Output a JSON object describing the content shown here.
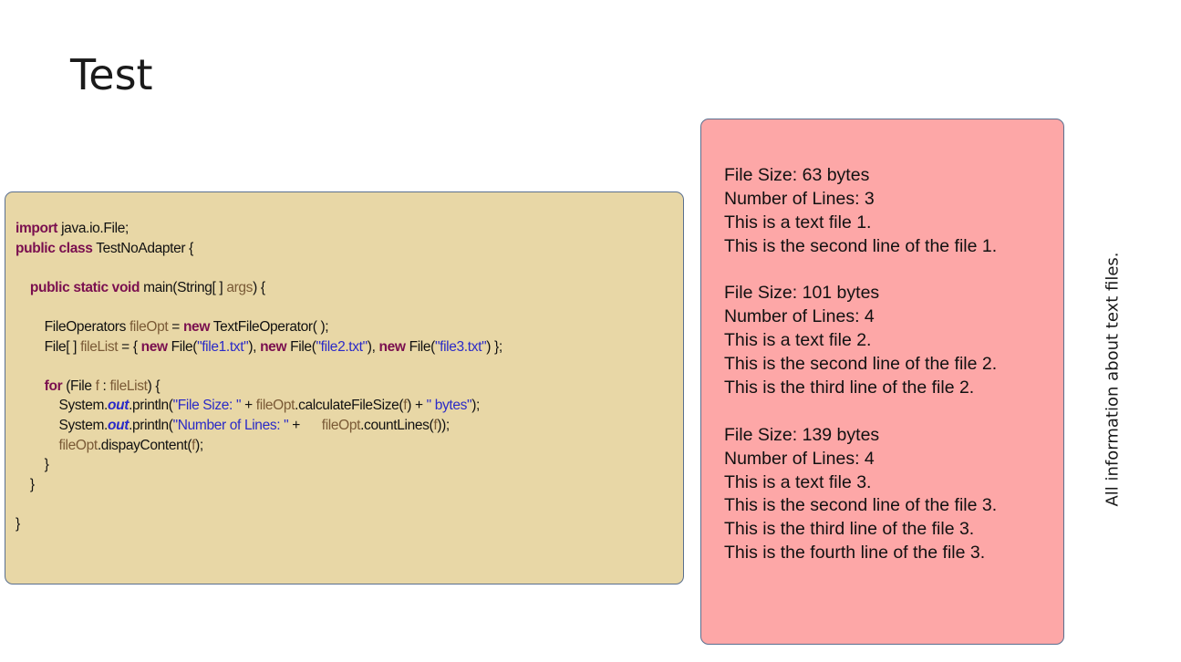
{
  "slide": {
    "title": "Test",
    "side_note": "All information about text files."
  },
  "code": {
    "lines": [
      [
        {
          "t": "import",
          "s": "kw"
        },
        {
          "t": " java.io.File;"
        }
      ],
      [
        {
          "t": "public class",
          "s": "kw"
        },
        {
          "t": " TestNoAdapter {"
        }
      ],
      [
        {
          "t": ""
        }
      ],
      [
        {
          "t": "    "
        },
        {
          "t": "public static void",
          "s": "kw"
        },
        {
          "t": " main(String[ ] "
        },
        {
          "t": "args",
          "s": "var"
        },
        {
          "t": ") {"
        }
      ],
      [
        {
          "t": ""
        }
      ],
      [
        {
          "t": "        FileOperators "
        },
        {
          "t": "fileOpt",
          "s": "var"
        },
        {
          "t": " = "
        },
        {
          "t": "new",
          "s": "kw"
        },
        {
          "t": " TextFileOperator( );"
        }
      ],
      [
        {
          "t": "        File[ ] "
        },
        {
          "t": "fileList",
          "s": "var"
        },
        {
          "t": " = { "
        },
        {
          "t": "new",
          "s": "kw"
        },
        {
          "t": " File("
        },
        {
          "t": "\"file1.txt\"",
          "s": "str"
        },
        {
          "t": "), "
        },
        {
          "t": "new",
          "s": "kw"
        },
        {
          "t": " File("
        },
        {
          "t": "\"file2.txt\"",
          "s": "str"
        },
        {
          "t": "), "
        },
        {
          "t": "new",
          "s": "kw"
        },
        {
          "t": " File("
        },
        {
          "t": "\"file3.txt\"",
          "s": "str"
        },
        {
          "t": ") };"
        }
      ],
      [
        {
          "t": ""
        }
      ],
      [
        {
          "t": "        "
        },
        {
          "t": "for",
          "s": "kw"
        },
        {
          "t": " (File "
        },
        {
          "t": "f",
          "s": "var"
        },
        {
          "t": " : "
        },
        {
          "t": "fileList",
          "s": "var"
        },
        {
          "t": ") {"
        }
      ],
      [
        {
          "t": "            System."
        },
        {
          "t": "out",
          "s": "fld"
        },
        {
          "t": ".println("
        },
        {
          "t": "\"File Size: \"",
          "s": "str"
        },
        {
          "t": " + "
        },
        {
          "t": "fileOpt",
          "s": "var"
        },
        {
          "t": ".calculateFileSize("
        },
        {
          "t": "f",
          "s": "var"
        },
        {
          "t": ") + "
        },
        {
          "t": "\" bytes\"",
          "s": "str"
        },
        {
          "t": ");"
        }
      ],
      [
        {
          "t": "            System."
        },
        {
          "t": "out",
          "s": "fld"
        },
        {
          "t": ".println("
        },
        {
          "t": "\"Number of Lines: \"",
          "s": "str"
        },
        {
          "t": " +      "
        },
        {
          "t": "fileOpt",
          "s": "var"
        },
        {
          "t": ".countLines("
        },
        {
          "t": "f",
          "s": "var"
        },
        {
          "t": "));"
        }
      ],
      [
        {
          "t": "            "
        },
        {
          "t": "fileOpt",
          "s": "var"
        },
        {
          "t": ".dispayContent("
        },
        {
          "t": "f",
          "s": "var"
        },
        {
          "t": ");"
        }
      ],
      [
        {
          "t": "        }"
        }
      ],
      [
        {
          "t": "    }"
        }
      ],
      [
        {
          "t": ""
        }
      ],
      [
        {
          "t": "}"
        }
      ]
    ]
  },
  "output": {
    "lines": [
      "File Size: 63 bytes",
      "Number of Lines: 3",
      "This is a text file 1.",
      "This is the second line of the file 1.",
      "",
      "File Size: 101 bytes",
      "Number of Lines: 4",
      "This is a text file 2.",
      "This is the second line of the file 2.",
      "This is the third line of the file 2.",
      "",
      "File Size: 139 bytes",
      "Number of Lines: 4",
      "This is a text file 3.",
      "This is the second line of the file 3.",
      "This is the third line of the file 3.",
      "This is the fourth line of the file 3."
    ]
  }
}
